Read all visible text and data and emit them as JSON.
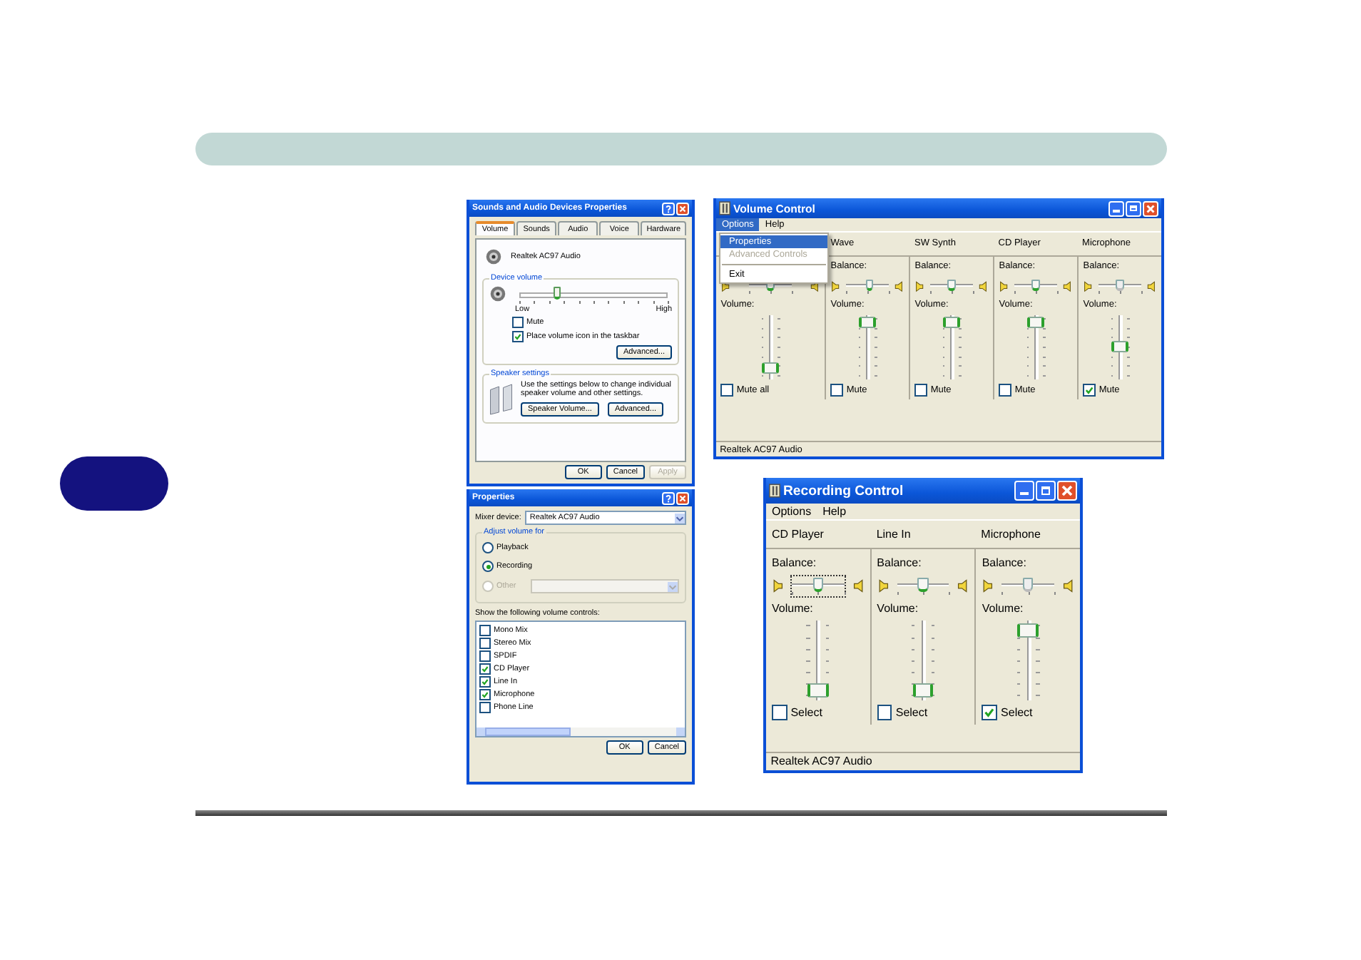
{
  "sounds_dialog": {
    "title": "Sounds and Audio Devices Properties",
    "tabs": [
      {
        "label": "Volume",
        "selected": true
      },
      {
        "label": "Sounds",
        "selected": false
      },
      {
        "label": "Audio",
        "selected": false
      },
      {
        "label": "Voice",
        "selected": false
      },
      {
        "label": "Hardware",
        "selected": false
      }
    ],
    "device_name": "Realtek AC97 Audio",
    "device_volume": {
      "title": "Device volume",
      "level": 0.25,
      "low_label": "Low",
      "high_label": "High"
    },
    "options": [
      {
        "label": "Mute",
        "checked": false
      },
      {
        "label": "Place volume icon in the taskbar",
        "checked": true
      }
    ],
    "advanced_button": "Advanced...",
    "speaker_settings": {
      "title": "Speaker settings",
      "text": "Use the settings below to change individual speaker volume and other settings.",
      "buttons": [
        "Speaker Volume...",
        "Advanced..."
      ]
    },
    "buttons": [
      {
        "label": "OK",
        "disabled": false
      },
      {
        "label": "Cancel",
        "disabled": false
      },
      {
        "label": "Apply",
        "disabled": true
      }
    ]
  },
  "properties_dialog": {
    "title": "Properties",
    "mixer_label": "Mixer device:",
    "mixer_device": "Realtek AC97 Audio",
    "adjust_title": "Adjust volume for",
    "modes": [
      {
        "label": "Playback",
        "selected": false,
        "disabled": false
      },
      {
        "label": "Recording",
        "selected": true,
        "disabled": false
      },
      {
        "label": "Other",
        "selected": false,
        "disabled": true
      }
    ],
    "controls_label": "Show the following volume controls:",
    "controls": [
      {
        "label": "Mono Mix",
        "checked": false
      },
      {
        "label": "Stereo Mix",
        "checked": false
      },
      {
        "label": "SPDIF",
        "checked": false
      },
      {
        "label": "CD Player",
        "checked": true
      },
      {
        "label": "Line In",
        "checked": true
      },
      {
        "label": "Microphone",
        "checked": true
      },
      {
        "label": "Phone Line",
        "checked": false
      }
    ],
    "buttons": [
      "OK",
      "Cancel"
    ]
  },
  "volume_control": {
    "title": "Volume Control",
    "menu": [
      {
        "label": "Options",
        "selected": true
      },
      {
        "label": "Help",
        "selected": false
      }
    ],
    "menu_items": [
      {
        "kind": "item",
        "label": "Properties",
        "selected": true,
        "disabled": false
      },
      {
        "kind": "item",
        "label": "Advanced Controls",
        "selected": false,
        "disabled": true
      },
      {
        "kind": "separator"
      },
      {
        "kind": "item",
        "label": "Exit",
        "selected": false,
        "disabled": false
      }
    ],
    "channels": [
      {
        "balance": {
          "level": 0.5,
          "disabled": false
        },
        "volume_label": "Volume:",
        "volume": {
          "level": 0.1
        },
        "checkbox": {
          "label": "Mute all",
          "checked": false
        }
      },
      {
        "name": "Wave",
        "balance_label": "Balance:",
        "balance": {
          "level": 0.55,
          "disabled": false
        },
        "volume_label": "Volume:",
        "volume": {
          "level": 0.95
        },
        "checkbox": {
          "label": "Mute",
          "checked": false
        }
      },
      {
        "name": "SW Synth",
        "balance_label": "Balance:",
        "balance": {
          "level": 0.5,
          "disabled": false
        },
        "volume_label": "Volume:",
        "volume": {
          "level": 0.95
        },
        "checkbox": {
          "label": "Mute",
          "checked": false
        }
      },
      {
        "name": "CD Player",
        "balance_label": "Balance:",
        "balance": {
          "level": 0.5,
          "disabled": false
        },
        "volume_label": "Volume:",
        "volume": {
          "level": 0.95
        },
        "checkbox": {
          "label": "Mute",
          "checked": false
        }
      },
      {
        "name": "Microphone",
        "balance_label": "Balance:",
        "balance": {
          "level": 0.5,
          "disabled": true
        },
        "volume_label": "Volume:",
        "volume": {
          "level": 0.5
        },
        "checkbox": {
          "label": "Mute",
          "checked": true
        }
      }
    ],
    "status": "Realtek AC97 Audio"
  },
  "recording_control": {
    "title": "Recording Control",
    "menu": [
      {
        "label": "Options",
        "selected": false
      },
      {
        "label": "Help",
        "selected": false
      }
    ],
    "channels": [
      {
        "name": "CD Player",
        "balance_label": "Balance:",
        "balance": {
          "level": 0.5,
          "disabled": false,
          "focused": true
        },
        "volume_label": "Volume:",
        "volume": {
          "level": 0.05
        },
        "checkbox": {
          "label": "Select",
          "checked": false
        }
      },
      {
        "name": "Line In",
        "balance_label": "Balance:",
        "balance": {
          "level": 0.5,
          "disabled": false,
          "focused": false
        },
        "volume_label": "Volume:",
        "volume": {
          "level": 0.05
        },
        "checkbox": {
          "label": "Select",
          "checked": false
        }
      },
      {
        "name": "Microphone",
        "balance_label": "Balance:",
        "balance": {
          "level": 0.5,
          "disabled": true,
          "focused": false
        },
        "volume_label": "Volume:",
        "volume": {
          "level": 0.95
        },
        "checkbox": {
          "label": "Select",
          "checked": true
        }
      }
    ],
    "status": "Realtek AC97 Audio"
  }
}
